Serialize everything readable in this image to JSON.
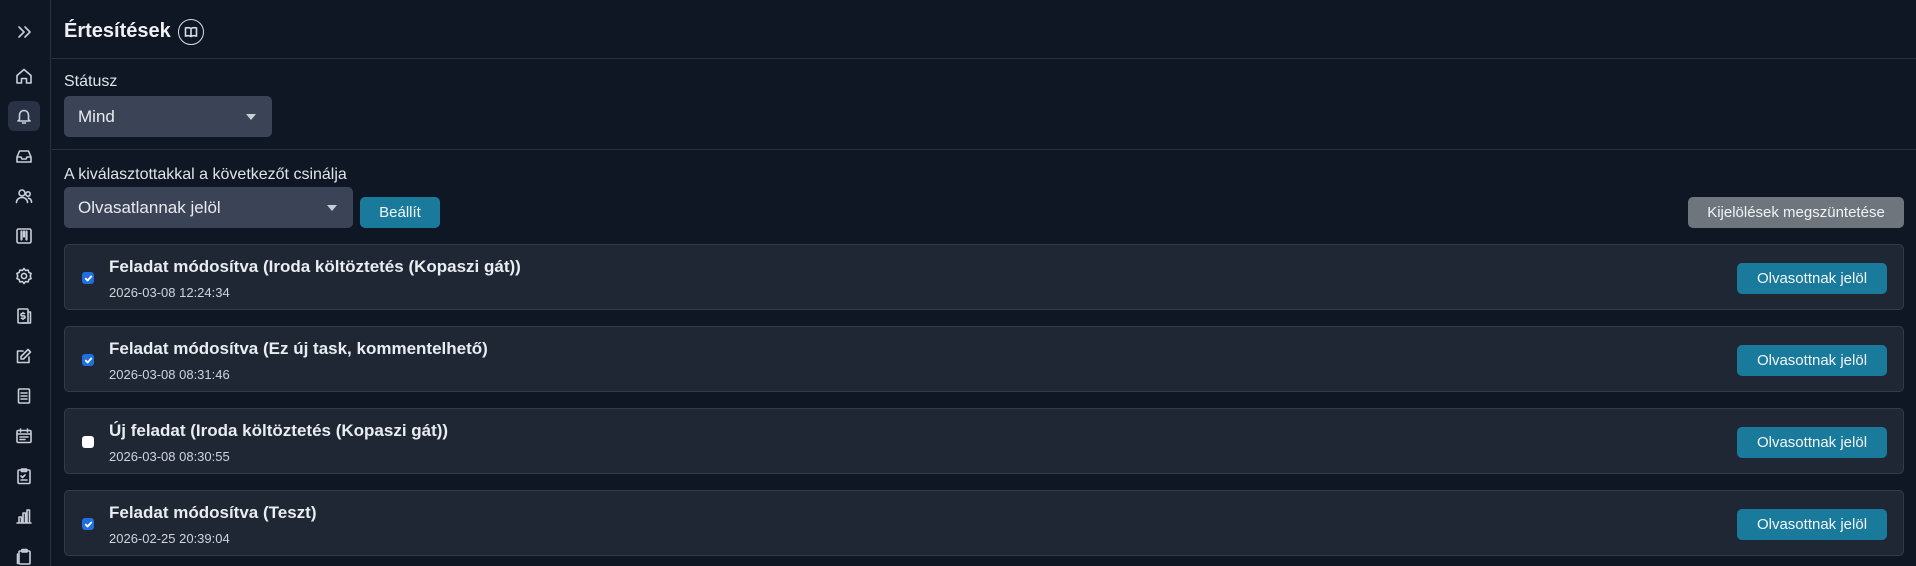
{
  "header": {
    "title": "Értesítések",
    "help_icon": "book-icon"
  },
  "sidebar": {
    "items": [
      {
        "name": "expand",
        "icon": "chevrons-right-icon",
        "active": false
      },
      {
        "name": "home",
        "icon": "home-icon",
        "active": false
      },
      {
        "name": "notifications",
        "icon": "bell-icon",
        "active": true
      },
      {
        "name": "inbox",
        "icon": "inbox-icon",
        "active": false
      },
      {
        "name": "users",
        "icon": "users-icon",
        "active": false
      },
      {
        "name": "board",
        "icon": "kanban-icon",
        "active": false
      },
      {
        "name": "settings",
        "icon": "gear-icon",
        "active": false
      },
      {
        "name": "finance",
        "icon": "dollar-doc-icon",
        "active": false
      },
      {
        "name": "edit",
        "icon": "edit-icon",
        "active": false
      },
      {
        "name": "documents",
        "icon": "document-icon",
        "active": false
      },
      {
        "name": "calendar",
        "icon": "calendar-icon",
        "active": false
      },
      {
        "name": "checklist",
        "icon": "clipboard-check-icon",
        "active": false
      },
      {
        "name": "reports",
        "icon": "bar-chart-icon",
        "active": false
      },
      {
        "name": "clipboard",
        "icon": "clipboard-icon",
        "active": false
      }
    ]
  },
  "filter": {
    "status_label": "Státusz",
    "status_value": "Mind"
  },
  "bulk": {
    "label": "A kiválasztottakkal a következőt csinálja",
    "action_value": "Olvasatlannak jelöl",
    "apply_label": "Beállít",
    "clear_label": "Kijelölések megszüntetése"
  },
  "notifications": [
    {
      "title": "Feladat módosítva (Iroda költöztetés (Kopaszi gát))",
      "date": "2026-03-08 12:24:34",
      "checked": true,
      "button": "Olvasottnak jelöl"
    },
    {
      "title": "Feladat módosítva (Ez új task, kommentelhető)",
      "date": "2026-03-08 08:31:46",
      "checked": true,
      "button": "Olvasottnak jelöl"
    },
    {
      "title": "Új feladat (Iroda költöztetés (Kopaszi gát))",
      "date": "2026-03-08 08:30:55",
      "checked": false,
      "button": "Olvasottnak jelöl"
    },
    {
      "title": "Feladat módosítva (Teszt)",
      "date": "2026-02-25 20:39:04",
      "checked": true,
      "button": "Olvasottnak jelöl"
    }
  ],
  "colors": {
    "background": "#0f1624",
    "card": "#1f2735",
    "primary_button": "#1a7a9c",
    "secondary_button": "#6e757d",
    "checkbox_checked": "#1f6fe0"
  }
}
